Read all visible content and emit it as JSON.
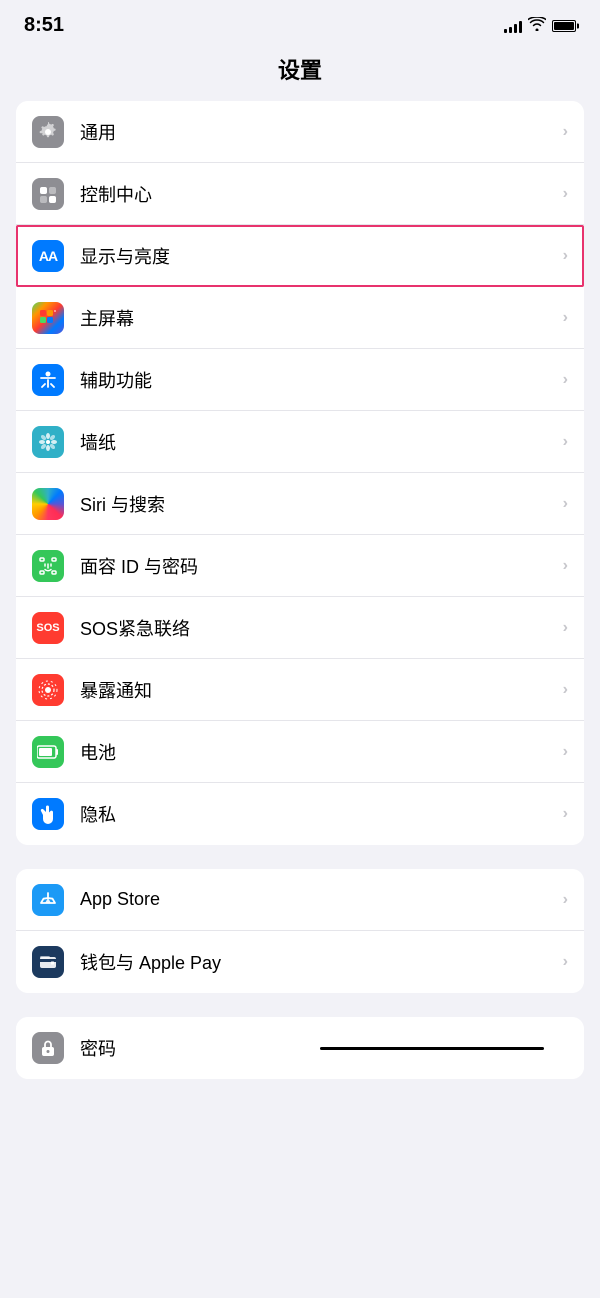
{
  "statusBar": {
    "time": "8:51",
    "batteryLevel": "full"
  },
  "pageTitle": "设置",
  "sections": [
    {
      "id": "section1",
      "items": [
        {
          "id": "tongyong",
          "icon": "gear",
          "iconBg": "gray",
          "label": "通用",
          "highlighted": false
        },
        {
          "id": "kongzhizhongxin",
          "icon": "toggle",
          "iconBg": "gray2",
          "label": "控制中心",
          "highlighted": false
        },
        {
          "id": "xianshiyuliangdu",
          "icon": "aa",
          "iconBg": "blue",
          "label": "显示与亮度",
          "highlighted": true
        },
        {
          "id": "zhupingmu",
          "icon": "grid",
          "iconBg": "colorful",
          "label": "主屏幕",
          "highlighted": false
        },
        {
          "id": "fuzhugongneng",
          "icon": "accessibility",
          "iconBg": "blue2",
          "label": "辅助功能",
          "highlighted": false
        },
        {
          "id": "qiangzhi",
          "icon": "flower",
          "iconBg": "teal",
          "label": "墙纸",
          "highlighted": false
        },
        {
          "id": "siri",
          "icon": "siri",
          "iconBg": "rainbow",
          "label": "Siri 与搜索",
          "highlighted": false
        },
        {
          "id": "mianrongid",
          "icon": "faceid",
          "iconBg": "green2",
          "label": "面容 ID 与密码",
          "highlighted": false
        },
        {
          "id": "sos",
          "icon": "sos",
          "iconBg": "red",
          "label": "SOS紧急联络",
          "highlighted": false
        },
        {
          "id": "baolu",
          "icon": "exposure",
          "iconBg": "red2",
          "label": "暴露通知",
          "highlighted": false
        },
        {
          "id": "diandian",
          "icon": "battery",
          "iconBg": "green3",
          "label": "电池",
          "highlighted": false
        },
        {
          "id": "yinsi",
          "icon": "hand",
          "iconBg": "blue3",
          "label": "隐私",
          "highlighted": false
        }
      ]
    },
    {
      "id": "section2",
      "items": [
        {
          "id": "appstore",
          "icon": "appstore",
          "iconBg": "appstore",
          "label": "App Store",
          "highlighted": false
        },
        {
          "id": "wallet",
          "icon": "wallet",
          "iconBg": "wallet",
          "label": "钱包与 Apple Pay",
          "highlighted": false
        }
      ]
    }
  ],
  "partialSection": {
    "item": {
      "id": "password",
      "icon": "password",
      "iconBg": "password",
      "label": "密码"
    }
  }
}
